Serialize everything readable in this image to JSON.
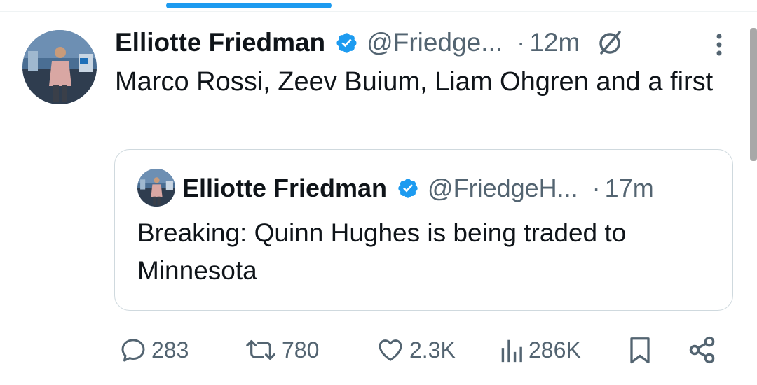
{
  "tweet": {
    "author_name": "Elliotte Friedman",
    "handle": "@Friedge...",
    "separator": "·",
    "time": "12m",
    "text": "Marco Rossi, Zeev Buium, Liam Ohgren and a first"
  },
  "quoted_tweet": {
    "author_name": "Elliotte Friedman",
    "handle": "@FriedgeH...",
    "separator": "·",
    "time": "17m",
    "text": "Breaking: Quinn Hughes is being traded to Minnesota"
  },
  "actions": {
    "replies": "283",
    "reposts": "780",
    "likes": "2.3K",
    "views": "286K"
  },
  "icons": [
    "verified-badge-icon",
    "grok-icon",
    "more-icon",
    "reply-icon",
    "repost-icon",
    "like-icon",
    "views-icon",
    "bookmark-icon",
    "share-icon"
  ],
  "colors": {
    "accent": "#1d9bf0",
    "text": "#0f1419",
    "secondary_text": "#536471",
    "border": "#cfd9de"
  }
}
